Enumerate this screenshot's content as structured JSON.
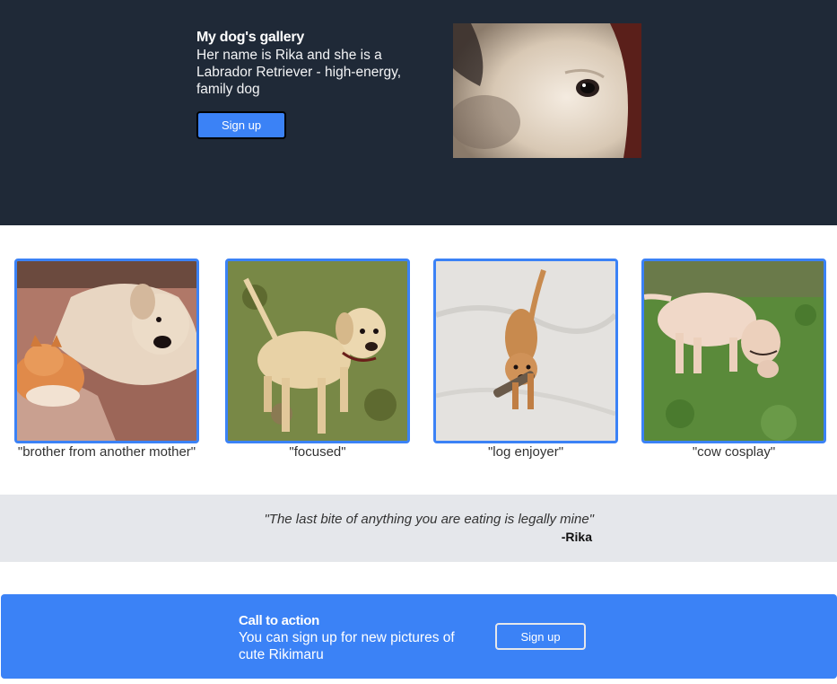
{
  "hero": {
    "title": "My dog's gallery",
    "description": "Her name is Rika and she is a Labrador Retriever - high-energy, family dog",
    "signup_label": "Sign up"
  },
  "gallery": {
    "items": [
      {
        "caption": "\"brother from another mother\""
      },
      {
        "caption": "\"focused\""
      },
      {
        "caption": "\"log enjoyer\""
      },
      {
        "caption": "\"cow cosplay\""
      }
    ]
  },
  "quote": {
    "text": "\"The last bite of anything you are eating is legally mine\"",
    "author": "-Rika"
  },
  "cta": {
    "title": "Call to action",
    "description": "You can sign up for new pictures of cute Rikimaru",
    "signup_label": "Sign up"
  },
  "colors": {
    "hero_bg": "#1f2937",
    "accent": "#3b82f6",
    "quote_bg": "#e5e7eb"
  },
  "icons": {
    "hero_photo": "dog-closeup-photo",
    "gallery_1": "dog-with-cat-photo",
    "gallery_2": "dog-on-grass-photo",
    "gallery_3": "dog-in-snow-photo",
    "gallery_4": "dog-sniffing-grass-photo"
  }
}
